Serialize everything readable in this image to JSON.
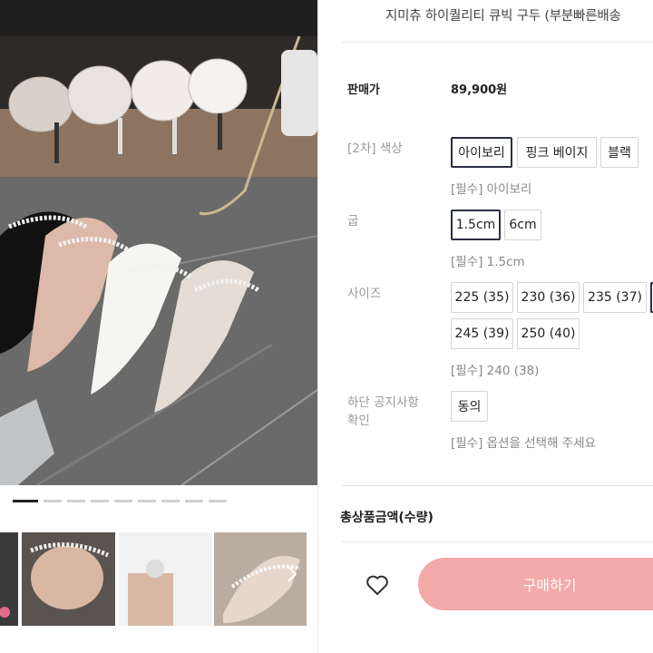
{
  "product": {
    "title": "지미츄 하이퀄리티 큐빅 구두 (부분빠른배송"
  },
  "price": {
    "label": "판매가",
    "value": "89,900원"
  },
  "options": {
    "color": {
      "label": "[2차] 색상",
      "choices": [
        "아이보리",
        "핑크 베이지",
        "블랙"
      ],
      "selected_note": "[필수] 아이보리"
    },
    "heel": {
      "label": "굽",
      "choices": [
        "1.5cm",
        "6cm"
      ],
      "selected_note": "[필수] 1.5cm"
    },
    "size": {
      "label": "사이즈",
      "choices": [
        "225 (35)",
        "230 (36)",
        "235 (37)",
        "245 (39)",
        "250 (40)"
      ],
      "selected_note": "[필수] 240 (38)"
    },
    "notice": {
      "label_line1": "하단 공지사항",
      "label_line2": "확인",
      "choices": [
        "동의"
      ],
      "selected_note": "[필수] 옵션을 선택해 주세요"
    }
  },
  "total_label": "총상품금액(수량)",
  "actions": {
    "buy_label": "구매하기",
    "wishlist_icon": "heart-icon",
    "next_icon": "chevron-right-icon"
  },
  "gallery": {
    "dot_count": 9,
    "active_dot": 0
  },
  "colors": {
    "accent_buy": "#f3a9a9",
    "selected_border": "#2b2e45"
  }
}
